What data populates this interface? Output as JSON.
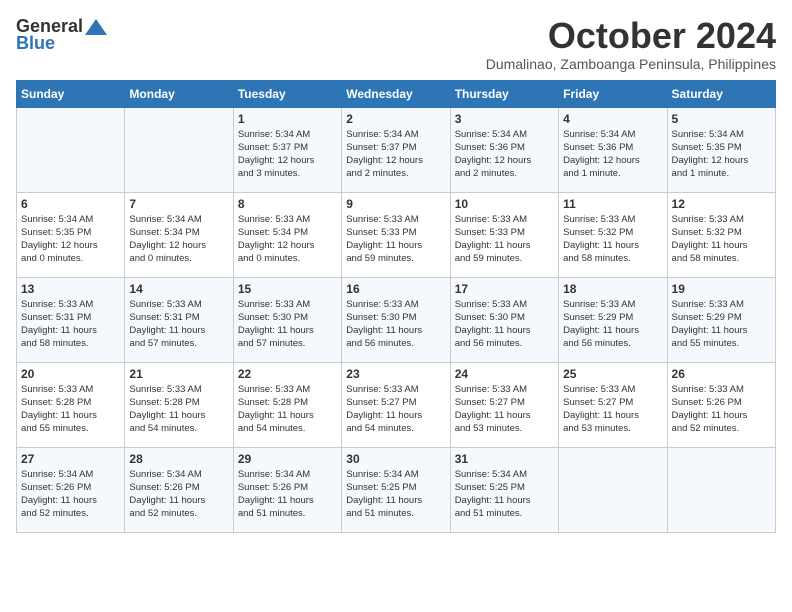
{
  "logo": {
    "line1": "General",
    "line2": "Blue"
  },
  "title": "October 2024",
  "subtitle": "Dumalinao, Zamboanga Peninsula, Philippines",
  "headers": [
    "Sunday",
    "Monday",
    "Tuesday",
    "Wednesday",
    "Thursday",
    "Friday",
    "Saturday"
  ],
  "weeks": [
    [
      {
        "day": "",
        "info": ""
      },
      {
        "day": "",
        "info": ""
      },
      {
        "day": "1",
        "info": "Sunrise: 5:34 AM\nSunset: 5:37 PM\nDaylight: 12 hours\nand 3 minutes."
      },
      {
        "day": "2",
        "info": "Sunrise: 5:34 AM\nSunset: 5:37 PM\nDaylight: 12 hours\nand 2 minutes."
      },
      {
        "day": "3",
        "info": "Sunrise: 5:34 AM\nSunset: 5:36 PM\nDaylight: 12 hours\nand 2 minutes."
      },
      {
        "day": "4",
        "info": "Sunrise: 5:34 AM\nSunset: 5:36 PM\nDaylight: 12 hours\nand 1 minute."
      },
      {
        "day": "5",
        "info": "Sunrise: 5:34 AM\nSunset: 5:35 PM\nDaylight: 12 hours\nand 1 minute."
      }
    ],
    [
      {
        "day": "6",
        "info": "Sunrise: 5:34 AM\nSunset: 5:35 PM\nDaylight: 12 hours\nand 0 minutes."
      },
      {
        "day": "7",
        "info": "Sunrise: 5:34 AM\nSunset: 5:34 PM\nDaylight: 12 hours\nand 0 minutes."
      },
      {
        "day": "8",
        "info": "Sunrise: 5:33 AM\nSunset: 5:34 PM\nDaylight: 12 hours\nand 0 minutes."
      },
      {
        "day": "9",
        "info": "Sunrise: 5:33 AM\nSunset: 5:33 PM\nDaylight: 11 hours\nand 59 minutes."
      },
      {
        "day": "10",
        "info": "Sunrise: 5:33 AM\nSunset: 5:33 PM\nDaylight: 11 hours\nand 59 minutes."
      },
      {
        "day": "11",
        "info": "Sunrise: 5:33 AM\nSunset: 5:32 PM\nDaylight: 11 hours\nand 58 minutes."
      },
      {
        "day": "12",
        "info": "Sunrise: 5:33 AM\nSunset: 5:32 PM\nDaylight: 11 hours\nand 58 minutes."
      }
    ],
    [
      {
        "day": "13",
        "info": "Sunrise: 5:33 AM\nSunset: 5:31 PM\nDaylight: 11 hours\nand 58 minutes."
      },
      {
        "day": "14",
        "info": "Sunrise: 5:33 AM\nSunset: 5:31 PM\nDaylight: 11 hours\nand 57 minutes."
      },
      {
        "day": "15",
        "info": "Sunrise: 5:33 AM\nSunset: 5:30 PM\nDaylight: 11 hours\nand 57 minutes."
      },
      {
        "day": "16",
        "info": "Sunrise: 5:33 AM\nSunset: 5:30 PM\nDaylight: 11 hours\nand 56 minutes."
      },
      {
        "day": "17",
        "info": "Sunrise: 5:33 AM\nSunset: 5:30 PM\nDaylight: 11 hours\nand 56 minutes."
      },
      {
        "day": "18",
        "info": "Sunrise: 5:33 AM\nSunset: 5:29 PM\nDaylight: 11 hours\nand 56 minutes."
      },
      {
        "day": "19",
        "info": "Sunrise: 5:33 AM\nSunset: 5:29 PM\nDaylight: 11 hours\nand 55 minutes."
      }
    ],
    [
      {
        "day": "20",
        "info": "Sunrise: 5:33 AM\nSunset: 5:28 PM\nDaylight: 11 hours\nand 55 minutes."
      },
      {
        "day": "21",
        "info": "Sunrise: 5:33 AM\nSunset: 5:28 PM\nDaylight: 11 hours\nand 54 minutes."
      },
      {
        "day": "22",
        "info": "Sunrise: 5:33 AM\nSunset: 5:28 PM\nDaylight: 11 hours\nand 54 minutes."
      },
      {
        "day": "23",
        "info": "Sunrise: 5:33 AM\nSunset: 5:27 PM\nDaylight: 11 hours\nand 54 minutes."
      },
      {
        "day": "24",
        "info": "Sunrise: 5:33 AM\nSunset: 5:27 PM\nDaylight: 11 hours\nand 53 minutes."
      },
      {
        "day": "25",
        "info": "Sunrise: 5:33 AM\nSunset: 5:27 PM\nDaylight: 11 hours\nand 53 minutes."
      },
      {
        "day": "26",
        "info": "Sunrise: 5:33 AM\nSunset: 5:26 PM\nDaylight: 11 hours\nand 52 minutes."
      }
    ],
    [
      {
        "day": "27",
        "info": "Sunrise: 5:34 AM\nSunset: 5:26 PM\nDaylight: 11 hours\nand 52 minutes."
      },
      {
        "day": "28",
        "info": "Sunrise: 5:34 AM\nSunset: 5:26 PM\nDaylight: 11 hours\nand 52 minutes."
      },
      {
        "day": "29",
        "info": "Sunrise: 5:34 AM\nSunset: 5:26 PM\nDaylight: 11 hours\nand 51 minutes."
      },
      {
        "day": "30",
        "info": "Sunrise: 5:34 AM\nSunset: 5:25 PM\nDaylight: 11 hours\nand 51 minutes."
      },
      {
        "day": "31",
        "info": "Sunrise: 5:34 AM\nSunset: 5:25 PM\nDaylight: 11 hours\nand 51 minutes."
      },
      {
        "day": "",
        "info": ""
      },
      {
        "day": "",
        "info": ""
      }
    ]
  ]
}
